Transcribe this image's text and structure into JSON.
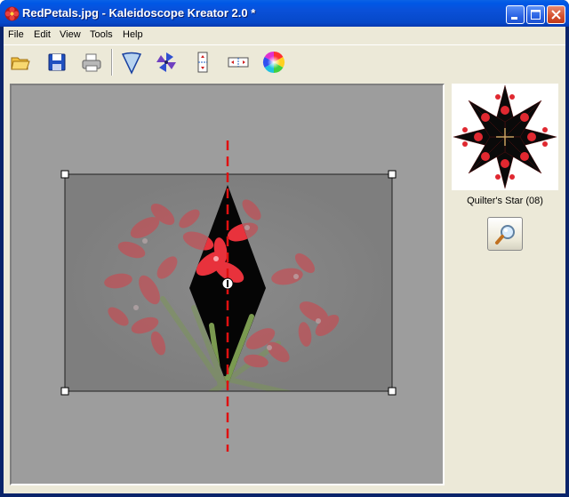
{
  "window": {
    "title": "RedPetals.jpg - Kaleidoscope Kreator 2.0 *",
    "icon": "flower-app-icon",
    "controls": [
      "minimize-icon",
      "maximize-icon",
      "close-icon"
    ]
  },
  "menu": {
    "items": [
      {
        "label": "File"
      },
      {
        "label": "Edit"
      },
      {
        "label": "View"
      },
      {
        "label": "Tools"
      },
      {
        "label": "Help"
      }
    ]
  },
  "toolbar": {
    "tools": [
      "open-folder-icon",
      "save-disk-icon",
      "print-icon",
      "cone-segment-icon",
      "pinwheel-icon",
      "vertical-mirror-icon",
      "horizontal-mirror-icon",
      "color-wheel-icon"
    ]
  },
  "preview": {
    "caption": "Quilter's Star (08)",
    "zoom_icon": "magnifier-icon"
  },
  "colors": {
    "titlebar": "#0054e3",
    "axis_line": "#e01010",
    "canvas_bg": "#9d9d9d",
    "petal_red": "#e8323c"
  }
}
